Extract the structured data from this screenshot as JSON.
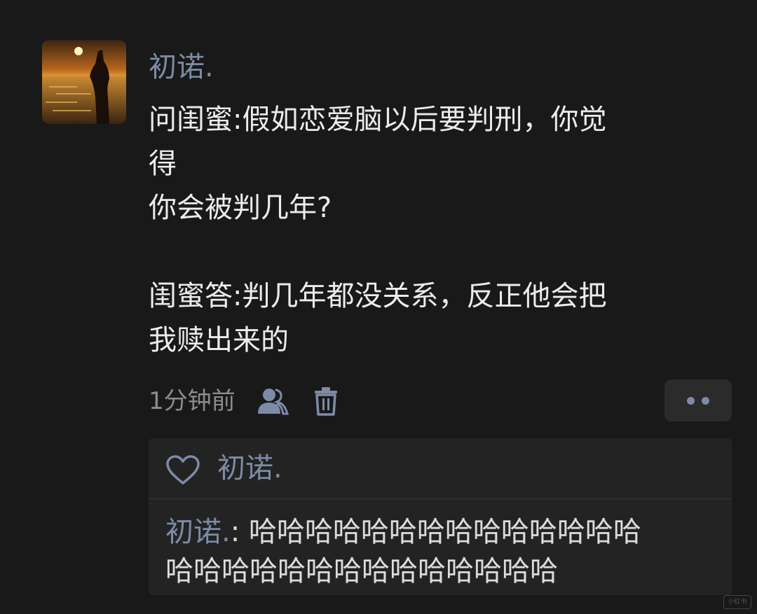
{
  "post": {
    "username": "初诺.",
    "text_lines": [
      "问闺蜜:假如恋爱脑以后要判刑，你觉",
      "得",
      "你会被判几年?",
      "",
      "闺蜜答:判几年都没关系，反正他会把",
      "我赎出来的"
    ],
    "time": "1分钟前"
  },
  "likes": {
    "names": "初诺."
  },
  "comment": {
    "author": "初诺.",
    "separator": ": ",
    "line1_text": "哈哈哈哈哈哈哈哈哈哈哈哈哈哈",
    "line2": "哈哈哈哈哈哈哈哈哈哈哈哈哈哈"
  },
  "watermark": "小红书",
  "colors": {
    "background": "#191919",
    "name_accent": "#7d8ba7",
    "body_text": "#ececec",
    "panel": "#232323"
  },
  "icons": {
    "people": "people-icon",
    "delete": "trash-icon",
    "more": "more-dots-icon",
    "like": "heart-icon"
  }
}
